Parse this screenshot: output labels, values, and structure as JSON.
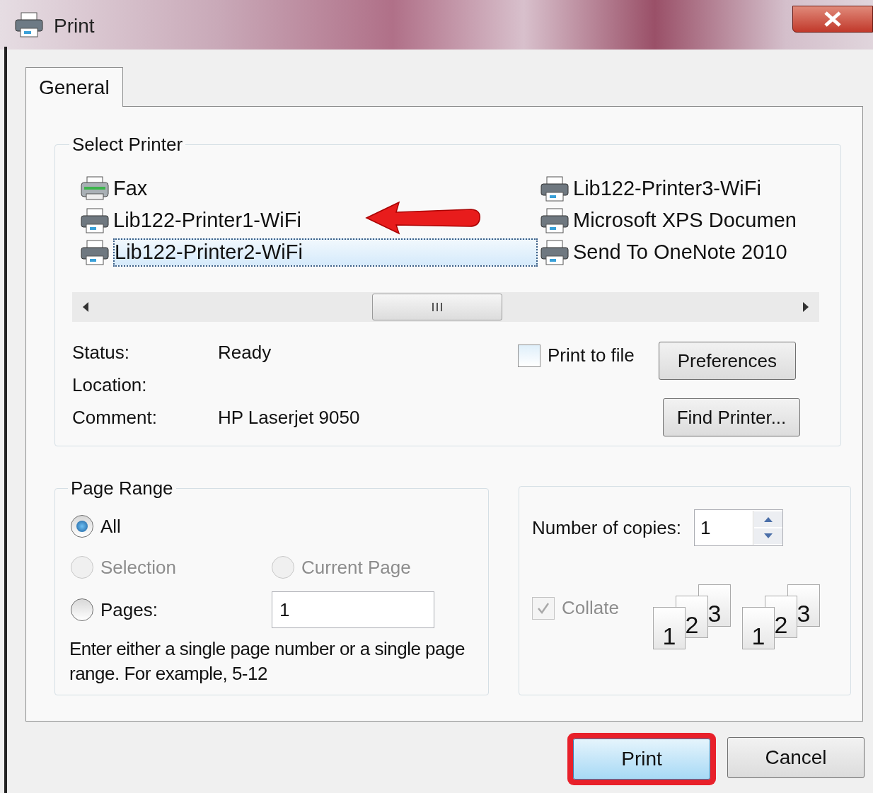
{
  "window": {
    "title": "Print"
  },
  "tabs": [
    {
      "label": "General",
      "selected": true
    }
  ],
  "select_printer": {
    "title": "Select Printer",
    "printers": [
      {
        "name": "Fax",
        "kind": "fax",
        "selected": false
      },
      {
        "name": "Lib122-Printer1-WiFi",
        "kind": "printer",
        "selected": false
      },
      {
        "name": "Lib122-Printer2-WiFi",
        "kind": "printer",
        "selected": true
      },
      {
        "name": "Lib122-Printer3-WiFi",
        "kind": "printer",
        "selected": false
      },
      {
        "name": "Microsoft XPS Documen",
        "kind": "printer",
        "selected": false
      },
      {
        "name": "Send To OneNote 2010",
        "kind": "printer",
        "selected": false
      }
    ],
    "info": [
      {
        "label": "Status:",
        "value": "Ready"
      },
      {
        "label": "Location:"
      },
      {
        "label": "Comment:",
        "value": "HP Laserjet 9050"
      }
    ],
    "print_to_file": {
      "label": "Print to file",
      "checked": false
    },
    "buttons": [
      "Preferences",
      "Find Printer..."
    ]
  },
  "page_range": {
    "title": "Page Range",
    "options": [
      {
        "label": "All",
        "selected": true,
        "disabled": false
      },
      {
        "label": "Selection",
        "selected": false,
        "disabled": true
      },
      {
        "label": "Current Page",
        "selected": false,
        "disabled": true
      },
      {
        "label": "Pages:",
        "selected": false,
        "disabled": false
      }
    ],
    "pages_value": "1",
    "hint": "Enter either a single page number or a single page range.  For example, 5-12"
  },
  "copies": {
    "label": "Number of copies:",
    "value": "1",
    "collate": {
      "label": "Collate",
      "checked": true,
      "disabled": true
    },
    "collate_pages": [
      [
        "1",
        "2",
        "3"
      ],
      [
        "1",
        "2",
        "3"
      ]
    ]
  },
  "buttons": [
    {
      "label": "Print",
      "highlighted": true
    },
    {
      "label": "Cancel",
      "highlighted": false
    }
  ]
}
